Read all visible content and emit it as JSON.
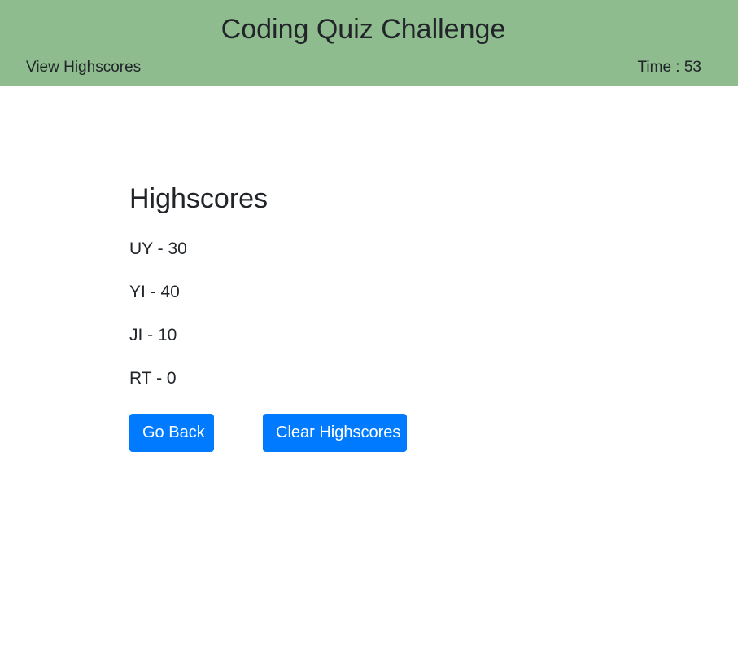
{
  "header": {
    "title": "Coding Quiz Challenge",
    "view_highscores": "View Highscores",
    "timer": "Time : 53",
    "background_color": "#8fbc8f"
  },
  "highscores": {
    "heading": "Highscores",
    "entries": [
      "UY - 30",
      "YI - 40",
      "JI - 10",
      "RT - 0"
    ]
  },
  "actions": {
    "go_back_label": "Go Back",
    "clear_label": "Clear Highscores",
    "button_color": "#007bff"
  }
}
